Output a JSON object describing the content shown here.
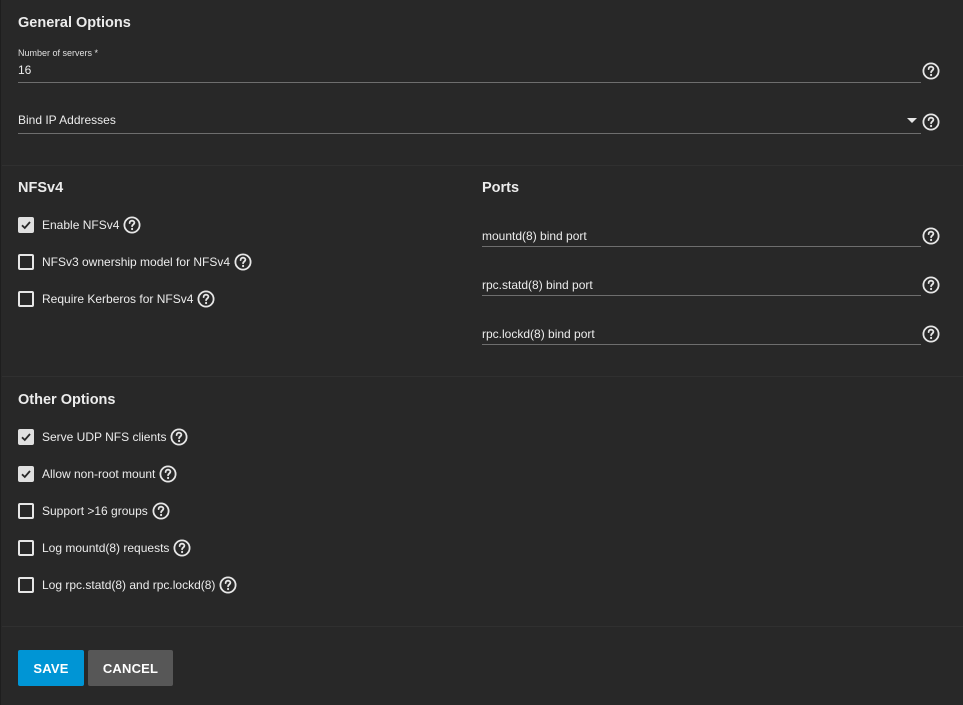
{
  "general": {
    "heading": "General Options",
    "servers": {
      "label": "Number of servers *",
      "value": "16"
    },
    "bind_ip": {
      "placeholder": "Bind IP Addresses"
    }
  },
  "nfsv4": {
    "heading": "NFSv4",
    "options": [
      {
        "label": "Enable NFSv4",
        "checked": true
      },
      {
        "label": "NFSv3 ownership model for NFSv4",
        "checked": false
      },
      {
        "label": "Require Kerberos for NFSv4",
        "checked": false
      }
    ]
  },
  "ports": {
    "heading": "Ports",
    "fields": [
      {
        "label": "mountd(8) bind port"
      },
      {
        "label": "rpc.statd(8) bind port"
      },
      {
        "label": "rpc.lockd(8) bind port"
      }
    ]
  },
  "other": {
    "heading": "Other Options",
    "options": [
      {
        "label": "Serve UDP NFS clients",
        "checked": true
      },
      {
        "label": "Allow non-root mount",
        "checked": true
      },
      {
        "label": "Support >16 groups",
        "checked": false
      },
      {
        "label": "Log mountd(8) requests",
        "checked": false
      },
      {
        "label": "Log rpc.statd(8) and rpc.lockd(8)",
        "checked": false
      }
    ]
  },
  "actions": {
    "save": "SAVE",
    "cancel": "CANCEL"
  },
  "colors": {
    "background": "#282828",
    "primary": "#0095d5",
    "secondary": "#575757",
    "text": "#ececec"
  },
  "icons": {
    "help": "help-circle-icon",
    "check": "check-icon",
    "dropdown": "dropdown-arrow-icon"
  }
}
